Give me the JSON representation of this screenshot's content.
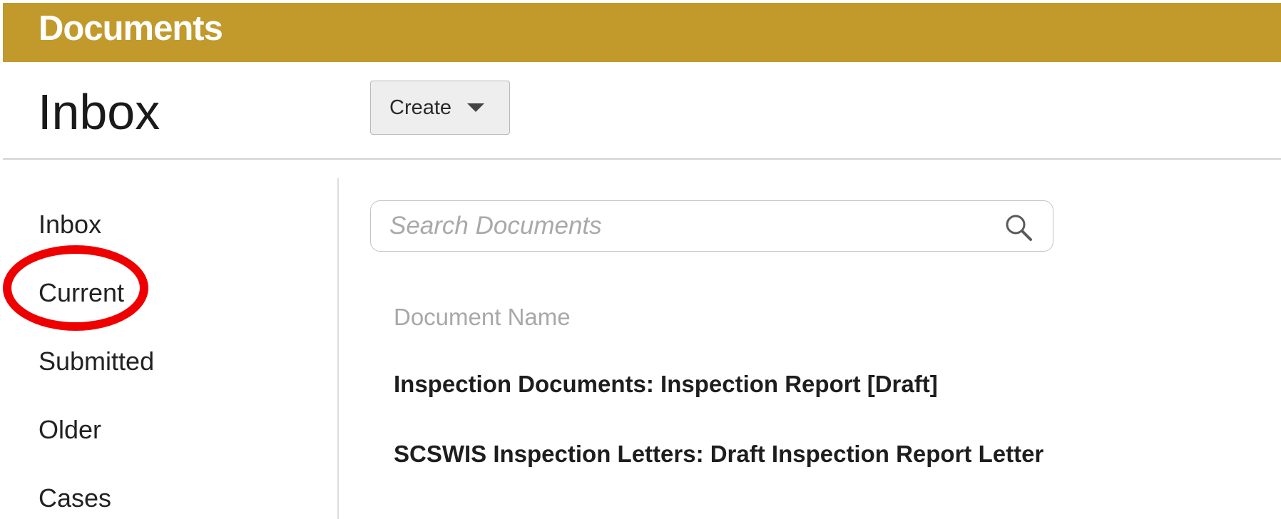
{
  "app": {
    "title": "Documents"
  },
  "header": {
    "page_title": "Inbox",
    "create_label": "Create"
  },
  "sidebar": {
    "items": [
      {
        "label": "Inbox"
      },
      {
        "label": "Current"
      },
      {
        "label": "Submitted"
      },
      {
        "label": "Older"
      },
      {
        "label": "Cases"
      }
    ]
  },
  "search": {
    "placeholder": "Search Documents",
    "value": ""
  },
  "table": {
    "column_header": "Document Name",
    "rows": [
      {
        "name": "Inspection Documents: Inspection Report [Draft]"
      },
      {
        "name": "SCSWIS Inspection Letters: Draft Inspection Report Letter"
      }
    ]
  },
  "annotation": {
    "color": "#ee0000"
  }
}
